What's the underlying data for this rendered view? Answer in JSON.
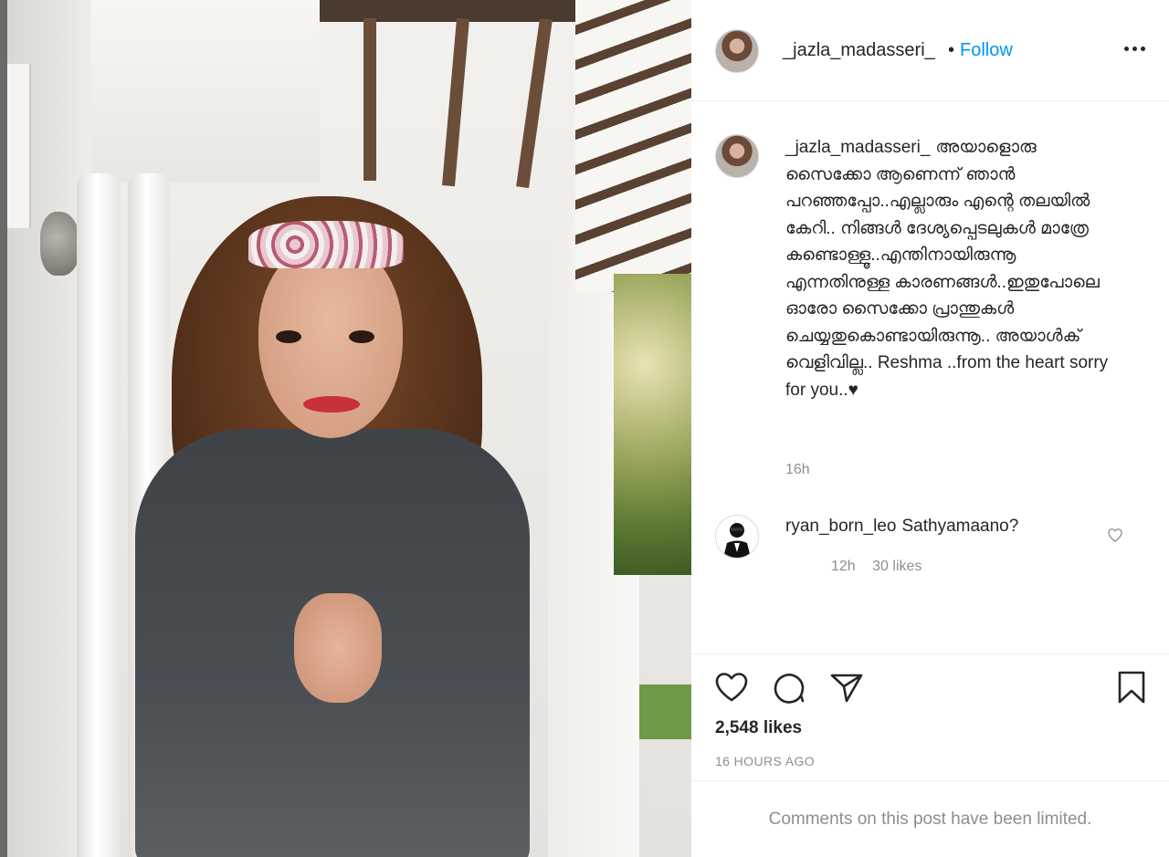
{
  "post": {
    "image_alt": "",
    "header": {
      "username": "_jazla_madasseri_",
      "separator": "•",
      "follow_label": "Follow",
      "more_icon": "more-horizontal-icon"
    },
    "caption": {
      "username": "_jazla_madasseri_",
      "text": "അയാളൊരു സൈക്കോ ആണെന്ന് ഞാൻ പറഞ്ഞപ്പോ..എല്ലാരും എന്റെ തലയിൽ കേറി.. നിങ്ങൾ ദേശ്യപ്പെടലുകൾ മാത്രേ കണ്ടൊള്ളൂ..എന്തിനായിരുന്നൂ എന്നതിനുള്ള കാരണങ്ങൾ..ഇതുപോലെ ഓരോ സൈക്കോ പ്രാന്തുകൾ ചെയ്യതുകൊണ്ടായിരുന്നൂ.. അയാൾക് വെളിവില്ല.. Reshma ..from the heart sorry for you..♥",
      "time": "16h"
    },
    "comments": [
      {
        "username": "ryan_born_leo",
        "text": "Sathyamaano?",
        "time": "12h",
        "likes": "30 likes",
        "heart_icon": "heart-outline-icon"
      }
    ],
    "actions": {
      "like_icon": "heart-icon",
      "comment_icon": "comment-icon",
      "share_icon": "send-icon",
      "save_icon": "bookmark-icon"
    },
    "likes_text": "2,548 likes",
    "posted_ago": "16 HOURS AGO",
    "comments_limited": "Comments on this post have been limited."
  },
  "colors": {
    "link": "#0095f6",
    "text": "#262626",
    "muted": "#8e8e8e",
    "divider": "#efefef"
  }
}
